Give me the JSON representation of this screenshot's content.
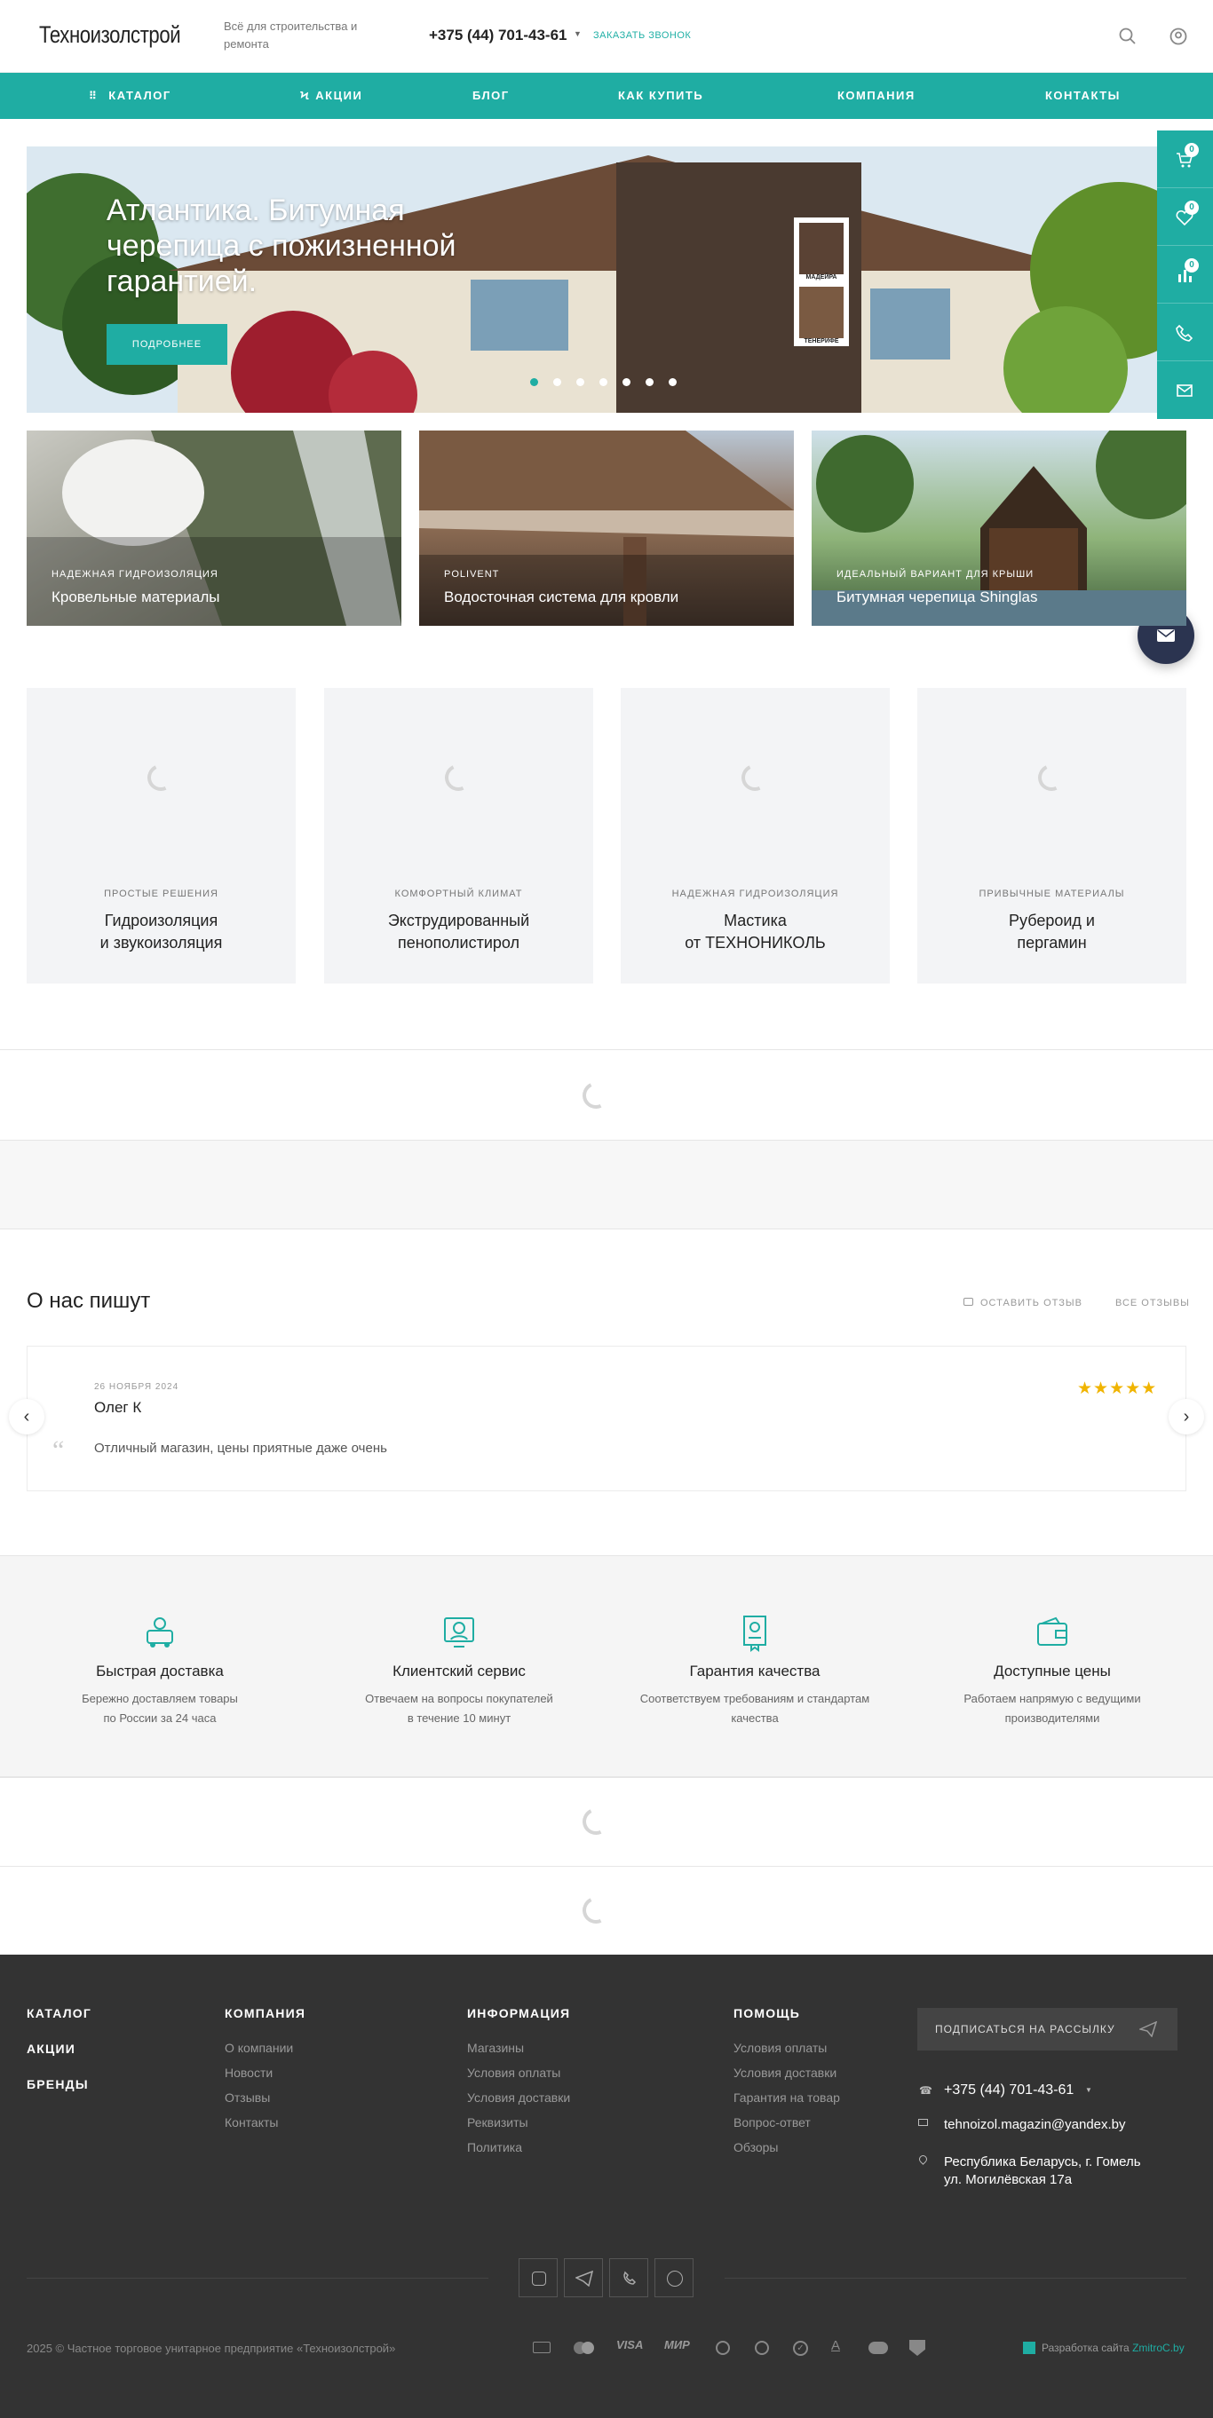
{
  "header": {
    "logo": "Техноизолстрой",
    "slogan": "Всё для строительства и ремонта",
    "phone": "+375 (44) 701-43-61",
    "callback": "ЗАКАЗАТЬ ЗВОНОК"
  },
  "nav": {
    "items": [
      {
        "label": "КАТАЛОГ",
        "icon": "grid-icon"
      },
      {
        "label": "АКЦИИ",
        "icon": "bolt-icon"
      },
      {
        "label": "БЛОГ"
      },
      {
        "label": "КАК КУПИТЬ"
      },
      {
        "label": "КОМПАНИЯ"
      },
      {
        "label": "КОНТАКТЫ"
      }
    ]
  },
  "banner": {
    "title": "Атлантика. Битумная черепица с пожизненной гарантией.",
    "button": "ПОДРОБНЕЕ",
    "sample_labels": [
      "МАДЕЙРА",
      "ТЕНЕРИФЕ"
    ],
    "slides_count": 7,
    "active_slide": 1
  },
  "side_panel": {
    "cart_count": "0",
    "wishlist_count": "0",
    "compare_count": "0"
  },
  "categories": [
    {
      "sub": "НАДЕЖНАЯ ГИДРОИЗОЛЯЦИЯ",
      "title": "Кровельные материалы"
    },
    {
      "sub": "POLIVENT",
      "title": "Водосточная система для кровли"
    },
    {
      "sub": "ИДЕАЛЬНЫЙ ВАРИАНТ ДЛЯ КРЫШИ",
      "title": "Битумная черепица Shinglas"
    }
  ],
  "tiles": [
    {
      "sub": "ПРОСТЫЕ РЕШЕНИЯ",
      "line1": "Гидроизоляция",
      "line2": "и звукоизоляция"
    },
    {
      "sub": "КОМФОРТНЫЙ КЛИМАТ",
      "line1": "Экструдированный",
      "line2": "пенополистирол"
    },
    {
      "sub": "НАДЕЖНАЯ ГИДРОИЗОЛЯЦИЯ",
      "line1": "Мастика",
      "line2": "от ТЕХНОНИКОЛЬ"
    },
    {
      "sub": "ПРИВЫЧНЫЕ МАТЕРИАЛЫ",
      "line1": "Рубероид и",
      "line2": "пергамин"
    }
  ],
  "reviews": {
    "heading": "О нас пишут",
    "leave_review": "ОСТАВИТЬ ОТЗЫВ",
    "all_reviews": "ВСЕ ОТЗЫВЫ",
    "items": [
      {
        "date": "26 НОЯБРЯ 2024",
        "author": "Олег К",
        "text": "Отличный магазин, цены приятные даже очень",
        "stars": "★★★★★",
        "rating": 5
      }
    ]
  },
  "features": [
    {
      "icon": "delivery-icon",
      "title": "Быстрая доставка",
      "line1": "Бережно доставляем товары",
      "line2": "по России за 24 часа"
    },
    {
      "icon": "support-icon",
      "title": "Клиентский сервис",
      "line1": "Отвечаем на вопросы покупателей",
      "line2": "в течение 10 минут"
    },
    {
      "icon": "certificate-icon",
      "title": "Гарантия качества",
      "line1": "Соответствуем требованиям и стандартам",
      "line2": "качества"
    },
    {
      "icon": "wallet-icon",
      "title": "Доступные цены",
      "line1": "Работаем напрямую с ведущими",
      "line2": "производителями"
    }
  ],
  "footer": {
    "col1": [
      "КАТАЛОГ",
      "АКЦИИ",
      "БРЕНДЫ"
    ],
    "company": {
      "title": "КОМПАНИЯ",
      "links": [
        "О компании",
        "Новости",
        "Отзывы",
        "Контакты"
      ]
    },
    "info": {
      "title": "ИНФОРМАЦИЯ",
      "links": [
        "Магазины",
        "Условия оплаты",
        "Условия доставки",
        "Реквизиты",
        "Политика"
      ]
    },
    "help": {
      "title": "ПОМОЩЬ",
      "links": [
        "Условия оплаты",
        "Условия доставки",
        "Гарантия на товар",
        "Вопрос-ответ",
        "Обзоры"
      ]
    },
    "subscribe": "ПОДПИСАТЬСЯ НА РАССЫЛКУ",
    "phone": "+375 (44) 701-43-61",
    "email": "tehnoizol.magazin@yandex.by",
    "address_line1": "Республика Беларусь, г. Гомель",
    "address_line2": "ул. Могилёвская 17а",
    "copyright": "2025 © Частное торговое унитарное предприятие «Техноизолстрой»",
    "payments": [
      "VISA",
      "МИР"
    ],
    "developer_label": "Разработка сайта",
    "developer_name": "ZmitroC.by"
  },
  "colors": {
    "accent": "#1fada3",
    "footer_bg": "#333333",
    "star": "#f0b400",
    "fab": "#2b3450"
  }
}
